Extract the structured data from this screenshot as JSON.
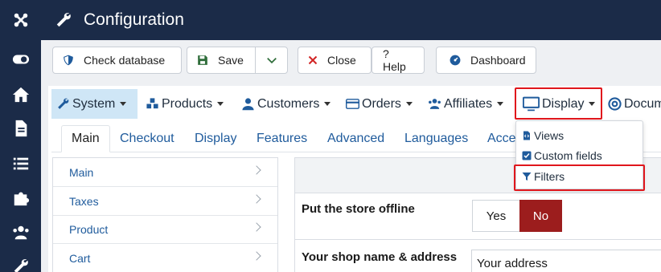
{
  "header": {
    "title": "Configuration"
  },
  "toolbar": {
    "check_database": "Check database",
    "save": "Save",
    "close": "Close",
    "help": "? Help",
    "dashboard": "Dashboard"
  },
  "menu": {
    "items": [
      "System",
      "Products",
      "Customers",
      "Orders",
      "Affiliates",
      "Display",
      "Docum"
    ]
  },
  "display_dropdown": {
    "items": [
      "Views",
      "Custom fields",
      "Filters"
    ]
  },
  "tabs": [
    "Main",
    "Checkout",
    "Display",
    "Features",
    "Advanced",
    "Languages",
    "Acce"
  ],
  "sidebar_list": [
    "Main",
    "Taxes",
    "Product",
    "Cart"
  ],
  "settings": {
    "store_offline_label": "Put the store offline",
    "yes": "Yes",
    "no": "No",
    "shop_name_label": "Your shop name & address",
    "shop_name_value": "Your address"
  },
  "colors": {
    "rail_bg": "#1b2b48",
    "no_active": "#9c1d1d",
    "highlight": "#e0161c",
    "menu_active": "#cfe6f6"
  }
}
